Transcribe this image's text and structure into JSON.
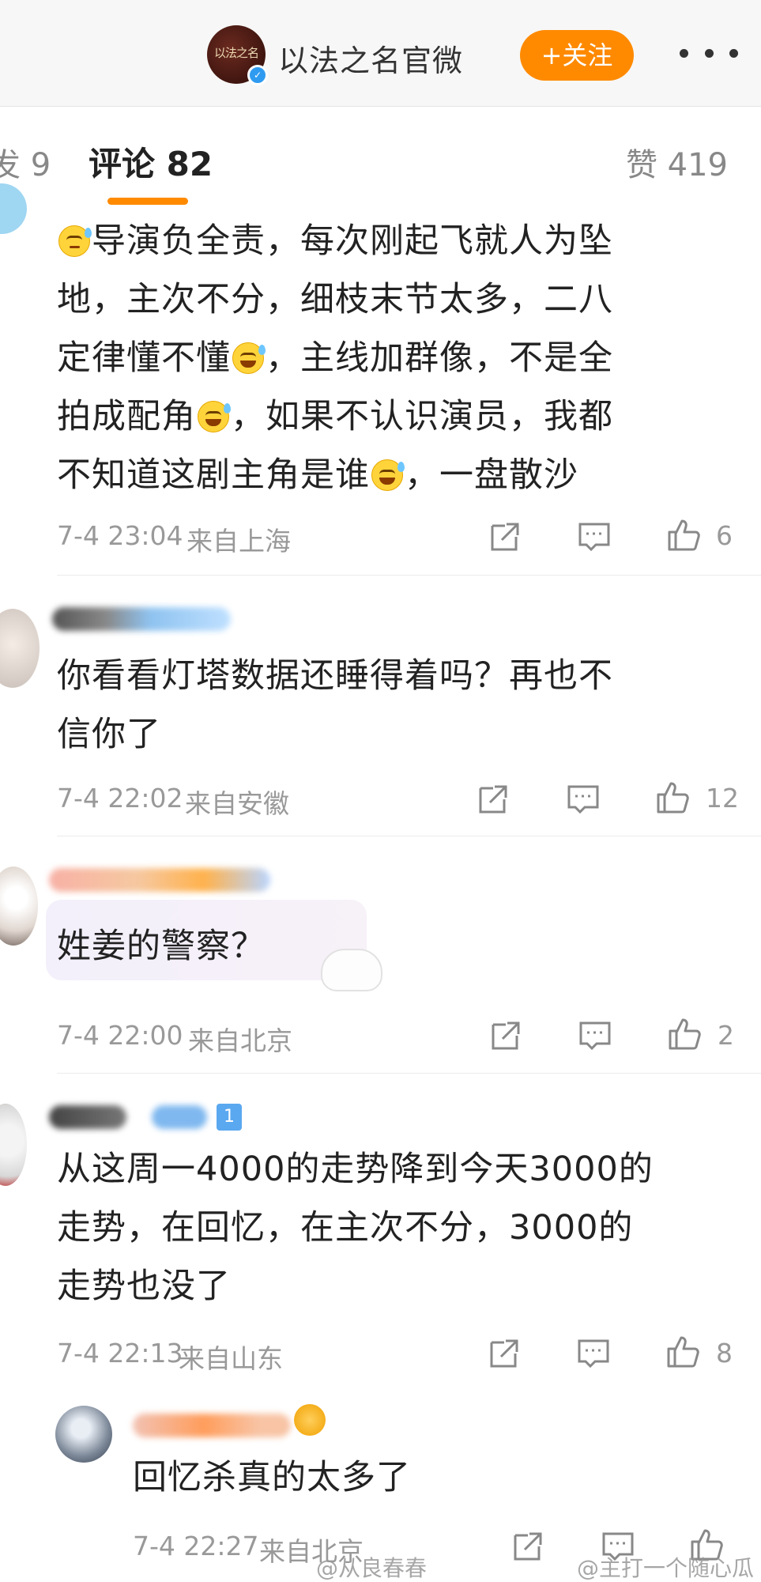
{
  "header": {
    "account_name": "以法之名官微",
    "avatar_logo_text": "以法之名",
    "follow_label": "+关注"
  },
  "tabs": {
    "forward_label": "发 9",
    "comments_label": "评论 82",
    "likes_label": "赞 419"
  },
  "comments": [
    {
      "lines": [
        "导演负全责，每次刚起飞就人为坠",
        "地，主次不分，细枝末节太多，二八",
        "定律懂不懂",
        "，主线加群像，不是全",
        "拍成配角",
        "，如果不认识演员，我都",
        "不知道这剧主角是谁",
        "，一盘散沙"
      ],
      "time": "7-4 23:04",
      "location": "来自上海",
      "likes": "6"
    },
    {
      "lines": [
        "你看看灯塔数据还睡得着吗？再也不",
        "信你了"
      ],
      "time": "7-4 22:02",
      "location": "来自安徽",
      "likes": "12"
    },
    {
      "lines": [
        "姓姜的警察？"
      ],
      "time": "7-4 22:00",
      "location": "来自北京",
      "likes": "2"
    },
    {
      "lines": [
        "从这周一4000的走势降到今天3000的",
        "走势，在回忆，在主次不分，3000的",
        "走势也没了"
      ],
      "time": "7-4 22:13",
      "location": "来自山东",
      "likes": "8",
      "badge": "1"
    },
    {
      "lines": [
        "回忆杀真的太多了"
      ],
      "time": "7-4 22:27",
      "location": "来自北京"
    }
  ],
  "watermarks": [
    "@从良春春",
    "@主打一个随心瓜"
  ],
  "icons": {
    "share": "share-icon",
    "comment": "comment-icon",
    "like": "like-icon",
    "more": "more-dots-icon",
    "verified": "verified-icon"
  },
  "colors": {
    "accent": "#ff8a00",
    "verified": "#2f9bf0",
    "meta_text": "#999999"
  }
}
